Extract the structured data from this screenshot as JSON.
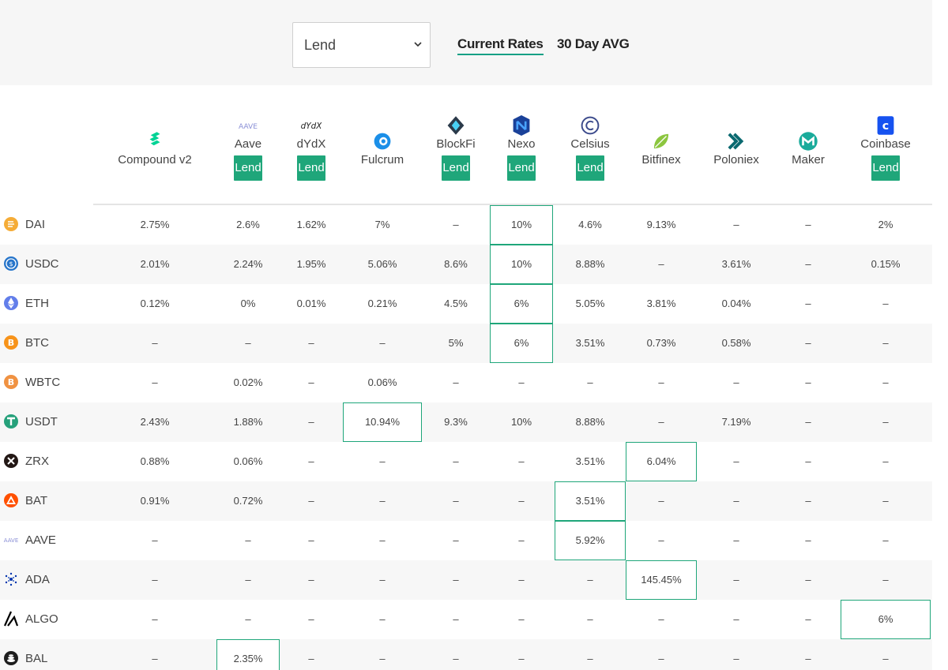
{
  "controls": {
    "mode_select": "Lend",
    "tabs": [
      {
        "label": "Current Rates",
        "active": true
      },
      {
        "label": "30 Day AVG",
        "active": false
      }
    ]
  },
  "accent_color": "#1fa67a",
  "providers": [
    {
      "name": "Compound v2",
      "icon": "compound-icon",
      "button": ""
    },
    {
      "name": "Aave",
      "icon": "aave-icon",
      "button": "Lend",
      "logo_text": "AAVE"
    },
    {
      "name": "dYdX",
      "icon": "dydx-icon",
      "button": "Lend",
      "logo_text": "dYdX"
    },
    {
      "name": "Fulcrum",
      "icon": "fulcrum-icon",
      "button": ""
    },
    {
      "name": "BlockFi",
      "icon": "blockfi-icon",
      "button": "Lend"
    },
    {
      "name": "Nexo",
      "icon": "nexo-icon",
      "button": "Lend"
    },
    {
      "name": "Celsius",
      "icon": "celsius-icon",
      "button": "Lend"
    },
    {
      "name": "Bitfinex",
      "icon": "bitfinex-icon",
      "button": ""
    },
    {
      "name": "Poloniex",
      "icon": "poloniex-icon",
      "button": ""
    },
    {
      "name": "Maker",
      "icon": "maker-icon",
      "button": ""
    },
    {
      "name": "Coinbase",
      "icon": "coinbase-icon",
      "button": "Lend"
    }
  ],
  "rows": [
    {
      "asset": "DAI",
      "icon": "dai-icon",
      "values": [
        "2.75%",
        "2.6%",
        "1.62%",
        "7%",
        "–",
        "10%",
        "4.6%",
        "9.13%",
        "–",
        "–",
        "2%"
      ],
      "best": 5
    },
    {
      "asset": "USDC",
      "icon": "usdc-icon",
      "values": [
        "2.01%",
        "2.24%",
        "1.95%",
        "5.06%",
        "8.6%",
        "10%",
        "8.88%",
        "–",
        "3.61%",
        "–",
        "0.15%"
      ],
      "best": 5
    },
    {
      "asset": "ETH",
      "icon": "eth-icon",
      "values": [
        "0.12%",
        "0%",
        "0.01%",
        "0.21%",
        "4.5%",
        "6%",
        "5.05%",
        "3.81%",
        "0.04%",
        "–",
        "–"
      ],
      "best": 5
    },
    {
      "asset": "BTC",
      "icon": "btc-icon",
      "values": [
        "–",
        "–",
        "–",
        "–",
        "5%",
        "6%",
        "3.51%",
        "0.73%",
        "0.58%",
        "–",
        "–"
      ],
      "best": 5
    },
    {
      "asset": "WBTC",
      "icon": "wbtc-icon",
      "values": [
        "–",
        "0.02%",
        "–",
        "0.06%",
        "–",
        "–",
        "–",
        "–",
        "–",
        "–",
        "–"
      ],
      "best": -1
    },
    {
      "asset": "USDT",
      "icon": "usdt-icon",
      "values": [
        "2.43%",
        "1.88%",
        "–",
        "10.94%",
        "9.3%",
        "10%",
        "8.88%",
        "–",
        "7.19%",
        "–",
        "–"
      ],
      "best": 3
    },
    {
      "asset": "ZRX",
      "icon": "zrx-icon",
      "values": [
        "0.88%",
        "0.06%",
        "–",
        "–",
        "–",
        "–",
        "3.51%",
        "6.04%",
        "–",
        "–",
        "–"
      ],
      "best": 7
    },
    {
      "asset": "BAT",
      "icon": "bat-icon",
      "values": [
        "0.91%",
        "0.72%",
        "–",
        "–",
        "–",
        "–",
        "3.51%",
        "–",
        "–",
        "–",
        "–"
      ],
      "best": 6
    },
    {
      "asset": "AAVE",
      "icon": "aave-icon",
      "values": [
        "–",
        "–",
        "–",
        "–",
        "–",
        "–",
        "5.92%",
        "–",
        "–",
        "–",
        "–"
      ],
      "best": 6
    },
    {
      "asset": "ADA",
      "icon": "ada-icon",
      "values": [
        "–",
        "–",
        "–",
        "–",
        "–",
        "–",
        "–",
        "145.45%",
        "–",
        "–",
        "–"
      ],
      "best": 7
    },
    {
      "asset": "ALGO",
      "icon": "algo-icon",
      "values": [
        "–",
        "–",
        "–",
        "–",
        "–",
        "–",
        "–",
        "–",
        "–",
        "–",
        "6%"
      ],
      "best": 10
    },
    {
      "asset": "BAL",
      "icon": "bal-icon",
      "values": [
        "–",
        "2.35%",
        "–",
        "–",
        "–",
        "–",
        "–",
        "–",
        "–",
        "–",
        "–"
      ],
      "best": 1
    }
  ]
}
